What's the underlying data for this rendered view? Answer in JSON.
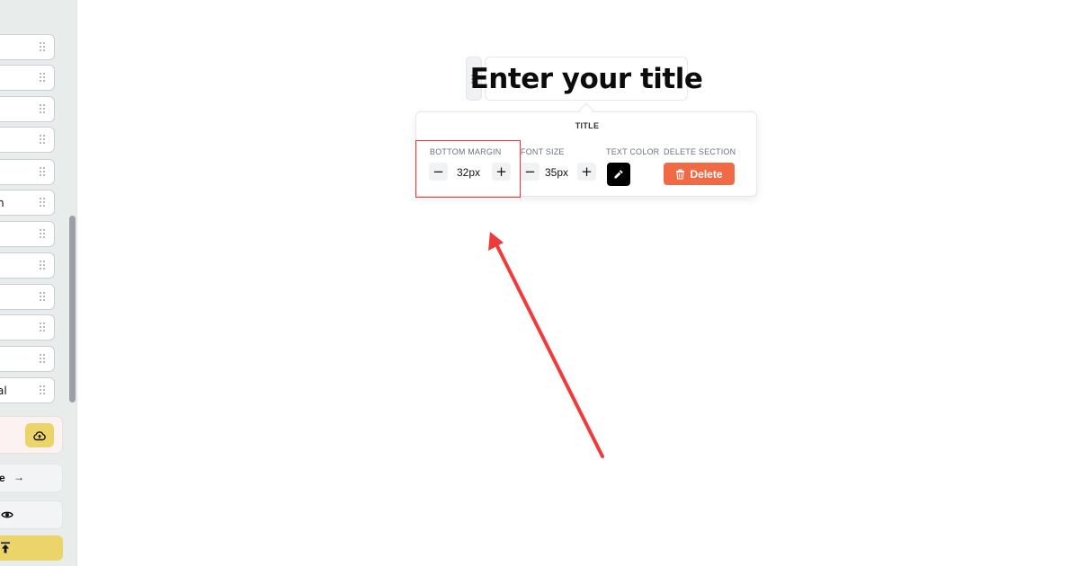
{
  "sidebar": {
    "items": [
      {
        "label": ""
      },
      {
        "label": ""
      },
      {
        "label": ""
      },
      {
        "label": ""
      },
      {
        "label": ""
      },
      {
        "label": "n"
      },
      {
        "label": ""
      },
      {
        "label": ""
      },
      {
        "label": ""
      },
      {
        "label": ""
      },
      {
        "label": ""
      },
      {
        "label": "al"
      }
    ],
    "next_label": "e"
  },
  "canvas": {
    "title_text": "Enter your title"
  },
  "panel": {
    "title": "TITLE",
    "bottom_margin": {
      "label": "BOTTOM MARGIN",
      "value": "32px"
    },
    "font_size": {
      "label": "FONT SIZE",
      "value": "35px"
    },
    "text_color": {
      "label": "TEXT COLOR",
      "color": "#000000"
    },
    "delete_section": {
      "label": "DELETE SECTION",
      "button_label": "Delete"
    }
  },
  "colors": {
    "accent_yellow": "#ebd56a",
    "delete_orange": "#f06a45",
    "annotation_red": "#e5373a"
  }
}
